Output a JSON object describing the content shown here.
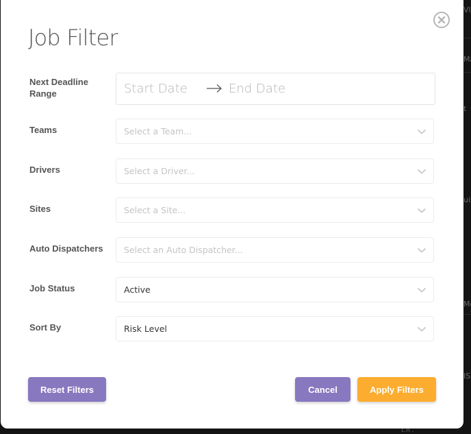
{
  "background": {
    "side_texts": [
      "VIS",
      "Ma",
      "t",
      "uis",
      "Me",
      "IS"
    ],
    "bottom_text": "LA."
  },
  "modal": {
    "title": "Job Filter",
    "close_icon": "circle-x-icon",
    "date_range": {
      "label": "Next Deadline Range",
      "start_placeholder": "Start Date",
      "end_placeholder": "End Date",
      "arrow_icon": "arrow-right-icon"
    },
    "filters": [
      {
        "label": "Teams",
        "placeholder": "Select a Team...",
        "value": null
      },
      {
        "label": "Drivers",
        "placeholder": "Select a Driver...",
        "value": null
      },
      {
        "label": "Sites",
        "placeholder": "Select a Site...",
        "value": null
      },
      {
        "label": "Auto Dispatchers",
        "placeholder": "Select an Auto Dispatcher...",
        "value": null
      },
      {
        "label": "Job Status",
        "placeholder": "",
        "value": "Active"
      },
      {
        "label": "Sort By",
        "placeholder": "",
        "value": "Risk Level"
      }
    ],
    "buttons": {
      "reset": "Reset Filters",
      "cancel": "Cancel",
      "apply": "Apply Filters"
    },
    "colors": {
      "primary_purple": "#8878bf",
      "accent_orange": "#fcad30",
      "label_gray": "#555555",
      "placeholder_gray": "#c4c4c4"
    }
  }
}
